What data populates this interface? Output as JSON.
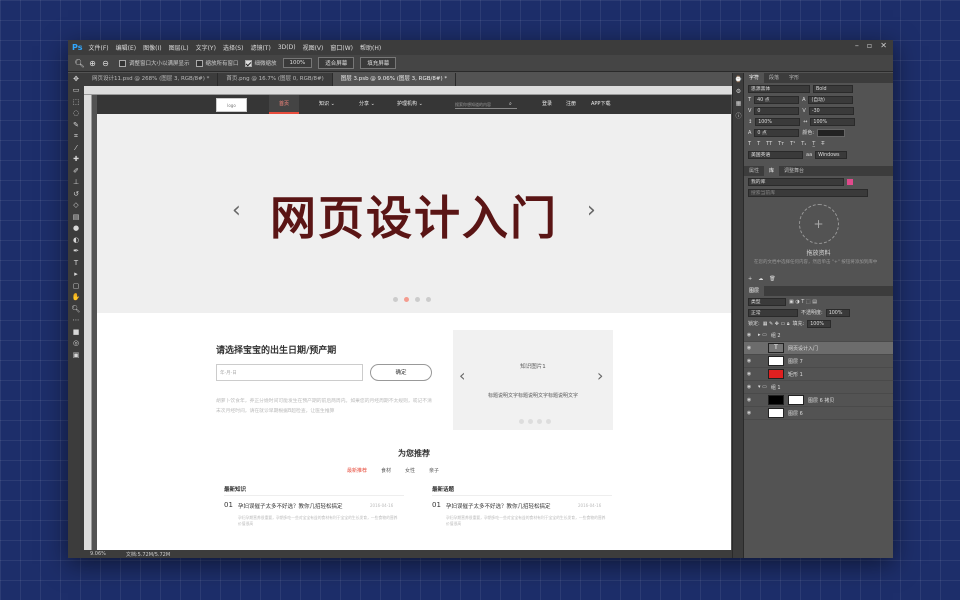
{
  "app": {
    "logo": "Ps",
    "menu": [
      "文件(F)",
      "编辑(E)",
      "图像(I)",
      "图层(L)",
      "文字(Y)",
      "选择(S)",
      "滤镜(T)",
      "3D(D)",
      "视图(V)",
      "窗口(W)",
      "帮助(H)"
    ]
  },
  "options": {
    "opt1": "调整窗口大小以满屏显示",
    "opt2": "缩放所有窗口",
    "opt3": "细微缩放",
    "zoom": "100%",
    "btn_fit": "适合屏幕",
    "btn_fill": "填充屏幕"
  },
  "tabs": [
    "网页设计11.psd @ 268% (图层 3, RGB/8#) *",
    "首页.png @ 16.7% (图层 0, RGB/8#)",
    "图层 3.psb @ 9.06% (图层 3, RGB/8#) *"
  ],
  "status": {
    "zoom": "9.06%",
    "doc": "文档:5.72M/5.72M"
  },
  "site": {
    "logo": "logo",
    "nav": [
      "首页",
      "知识",
      "分享",
      "护理机构"
    ],
    "search_placeholder": "搜索你想知道的内容",
    "login": "登录",
    "register": "注册",
    "app_download": "APP下载",
    "banner_title": "网页设计入门",
    "date_title": "请选择宝宝的出生日期/预产期",
    "date_placeholder": "年-月-日",
    "confirm": "确定",
    "desc": "胡萝卜饮食年，养正分娩时间可能发生在预产期的前后两周内。如果您的月经周期不太规则，或记不清末次月经时间，请在就诊早期根据B超检查，让医生推算",
    "knowledge_title": "知识图片1",
    "knowledge_text": "标题说明文字标题说明文字标题说明文字",
    "rec_title": "为您推荐",
    "rec_tabs": [
      "最新推荐",
      "食材",
      "女性",
      "亲子"
    ],
    "col1": {
      "head": "最新知识",
      "num": "01",
      "title": "孕妇误催子太多不好选？教你几招轻松搞定",
      "date": "2016-04-16",
      "summary": "孕妇孕期营养很重要，孕期多吃一些对宝宝有益的食材有利于宝宝的生长发育，一些食物的营养价值很高"
    },
    "col2": {
      "head": "最新话题",
      "num": "01",
      "title": "孕妇误催子太多不好选？教你几招轻松搞定",
      "date": "2016-04-16",
      "summary": "孕妇孕期营养很重要，孕期多吃一些对宝宝有益的食材有利于宝宝的生长发育，一些食物的营养价值很高"
    }
  },
  "panel": {
    "char_tabs": [
      "字符",
      "段落",
      "字形"
    ],
    "font": "思源黑体",
    "weight": "Bold",
    "size": "40 点",
    "leading": "(自动)",
    "kerning": "0",
    "tracking": "-30",
    "vscale": "100%",
    "hscale": "100%",
    "baseline": "0 点",
    "color_label": "颜色:",
    "lang": "美国英语",
    "aa": "Windows",
    "lib_tabs": [
      "属性",
      "库",
      "调整舞台"
    ],
    "lib_name": "我的库",
    "lib_search": "搜索当前库",
    "drop_title": "拖放资料",
    "drop_desc": "在您的文档中选择任何内容，然后单击 \"+\" 按钮将添加到库中",
    "layers_title": "图层",
    "kind": "类型",
    "blend": "正常",
    "opacity_label": "不透明度:",
    "opacity": "100%",
    "lock_label": "锁定:",
    "fill_label": "填充:",
    "fill": "100%",
    "layers": [
      "组 2",
      "网页设计入门",
      "图层 7",
      "矩形 1",
      "组 1",
      "图层 6 拷贝",
      "图层 6"
    ]
  }
}
